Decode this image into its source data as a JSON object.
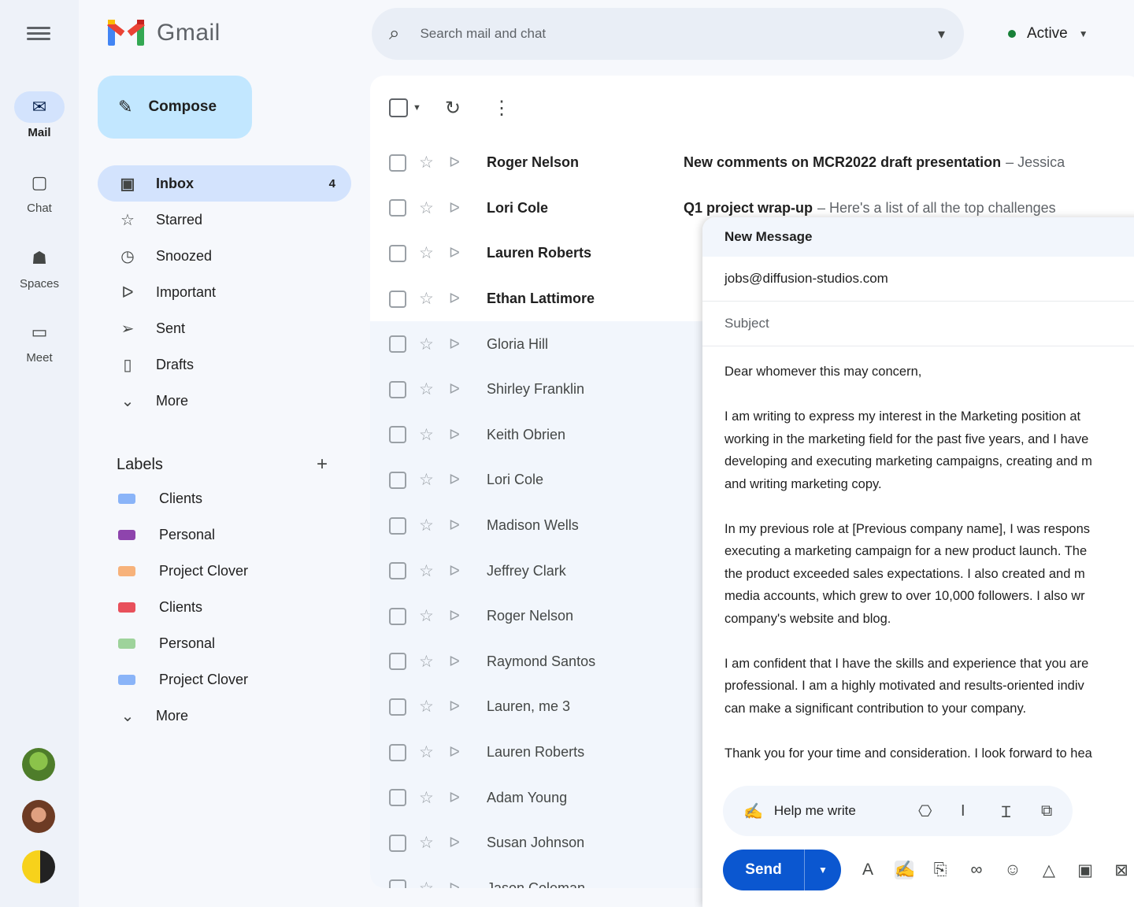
{
  "rail": {
    "items": [
      {
        "label": "Mail",
        "icon": "mail-icon",
        "glyph": "✉",
        "active": true
      },
      {
        "label": "Chat",
        "icon": "chat-icon",
        "glyph": "▢",
        "active": false
      },
      {
        "label": "Spaces",
        "icon": "spaces-icon",
        "glyph": "☗",
        "active": false
      },
      {
        "label": "Meet",
        "icon": "meet-icon",
        "glyph": "▭",
        "active": false
      }
    ]
  },
  "brand": {
    "name": "Gmail"
  },
  "compose_button": {
    "label": "Compose"
  },
  "search": {
    "placeholder": "Search mail and chat"
  },
  "status": {
    "label": "Active",
    "color": "#188038"
  },
  "nav": {
    "items": [
      {
        "label": "Inbox",
        "icon": "inbox-icon",
        "glyph": "▣",
        "count": "4",
        "active": true
      },
      {
        "label": "Starred",
        "icon": "star-icon",
        "glyph": "☆",
        "count": "",
        "active": false
      },
      {
        "label": "Snoozed",
        "icon": "clock-icon",
        "glyph": "◷",
        "count": "",
        "active": false
      },
      {
        "label": "Important",
        "icon": "important-icon",
        "glyph": "ᐅ",
        "count": "",
        "active": false
      },
      {
        "label": "Sent",
        "icon": "send-icon",
        "glyph": "➢",
        "count": "",
        "active": false
      },
      {
        "label": "Drafts",
        "icon": "draft-icon",
        "glyph": "▯",
        "count": "",
        "active": false
      },
      {
        "label": "More",
        "icon": "chevron-down-icon",
        "glyph": "⌄",
        "count": "",
        "active": false
      }
    ]
  },
  "labels": {
    "heading": "Labels",
    "items": [
      {
        "name": "Clients",
        "color": "#8ab4f8"
      },
      {
        "name": "Personal",
        "color": "#8e44ad"
      },
      {
        "name": "Project Clover",
        "color": "#f7b27a"
      },
      {
        "name": "Clients",
        "color": "#e8505b"
      },
      {
        "name": "Personal",
        "color": "#9ed39b"
      },
      {
        "name": "Project Clover",
        "color": "#8ab4f8"
      }
    ],
    "more": "More"
  },
  "emails": [
    {
      "sender": "Roger Nelson",
      "subject": "New comments on MCR2022 draft presentation",
      "snippet": "– Jessica",
      "unread": true
    },
    {
      "sender": "Lori Cole",
      "subject": "Q1 project wrap-up",
      "snippet": "– Here's a list of all the top challenges",
      "unread": true
    },
    {
      "sender": "Lauren Roberts",
      "subject": "",
      "snippet": "",
      "unread": true
    },
    {
      "sender": "Ethan Lattimore",
      "subject": "",
      "snippet": "",
      "unread": true
    },
    {
      "sender": "Gloria Hill",
      "subject": "",
      "snippet": "",
      "unread": false
    },
    {
      "sender": "Shirley Franklin",
      "subject": "",
      "snippet": "",
      "unread": false
    },
    {
      "sender": "Keith Obrien",
      "subject": "",
      "snippet": "",
      "unread": false
    },
    {
      "sender": "Lori Cole",
      "subject": "",
      "snippet": "",
      "unread": false
    },
    {
      "sender": "Madison Wells",
      "subject": "",
      "snippet": "",
      "unread": false
    },
    {
      "sender": "Jeffrey Clark",
      "subject": "",
      "snippet": "",
      "unread": false
    },
    {
      "sender": "Roger Nelson",
      "subject": "",
      "snippet": "",
      "unread": false
    },
    {
      "sender": "Raymond Santos",
      "subject": "",
      "snippet": "",
      "unread": false
    },
    {
      "sender": "Lauren, me 3",
      "subject": "",
      "snippet": "",
      "unread": false
    },
    {
      "sender": "Lauren Roberts",
      "subject": "",
      "snippet": "",
      "unread": false
    },
    {
      "sender": "Adam Young",
      "subject": "",
      "snippet": "",
      "unread": false
    },
    {
      "sender": "Susan Johnson",
      "subject": "",
      "snippet": "",
      "unread": false
    },
    {
      "sender": "Jason Coleman",
      "subject": "",
      "snippet": "",
      "unread": false
    }
  ],
  "compose_window": {
    "title": "New Message",
    "to": "jobs@diffusion-studios.com",
    "subject_placeholder": "Subject",
    "body": [
      [
        "Dear whomever this may concern,"
      ],
      [
        "I am writing to express my interest in the Marketing position at",
        "working in the marketing field for the past five years, and I have",
        "developing and executing marketing campaigns, creating and m",
        "and writing marketing copy."
      ],
      [
        "In my previous role at [Previous company name], I was respons",
        "executing a marketing campaign for a new product launch. The",
        "the product exceeded sales expectations. I also created and m",
        "media accounts, which grew to over 10,000 followers. I also wr",
        "company's website and blog."
      ],
      [
        "I am confident that I have the skills and experience that you are",
        "professional. I am a highly motivated and results-oriented indiv",
        "can make a significant contribution to your company."
      ],
      [
        "Thank you for your time and consideration. I look forward to hea"
      ]
    ],
    "help_me_write": "Help me write",
    "send_label": "Send"
  }
}
